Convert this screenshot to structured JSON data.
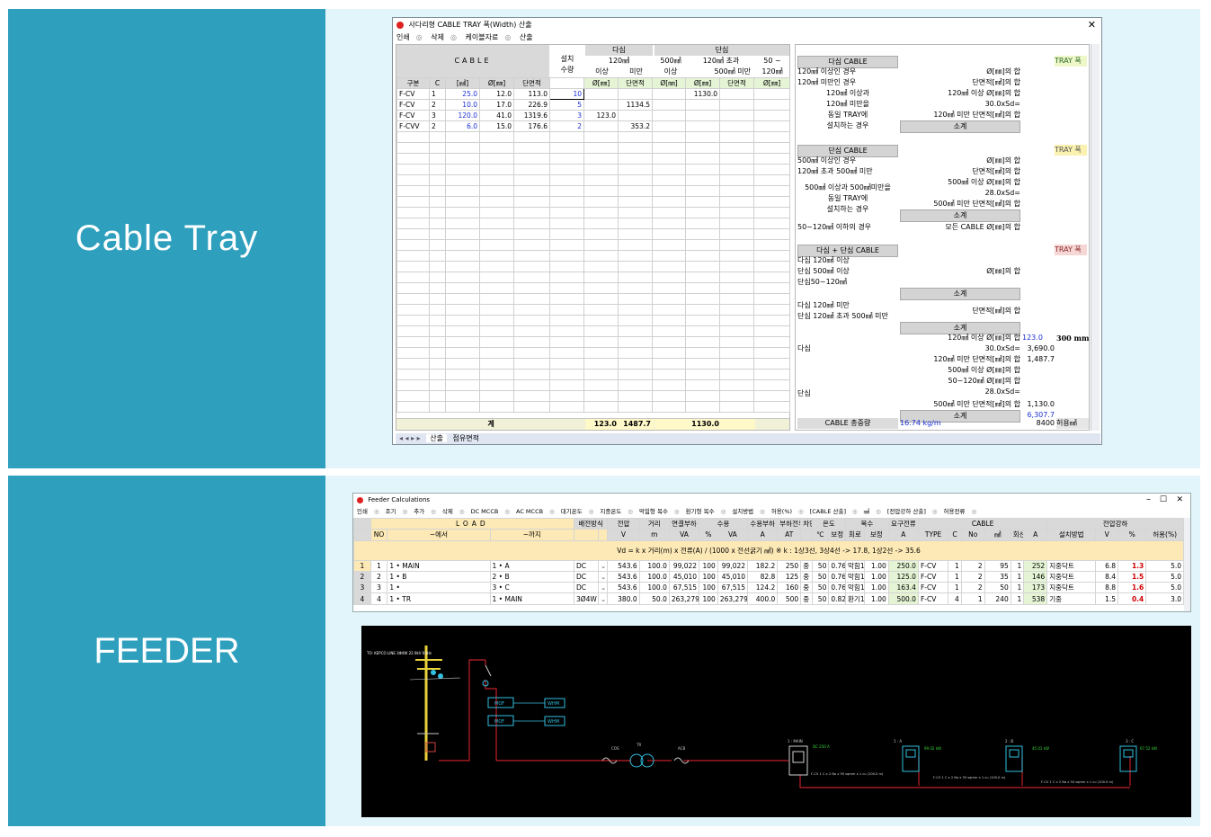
{
  "bands": {
    "top": "Cable Tray",
    "bottom": "FEEDER"
  },
  "tray": {
    "title": "사다리형 CABLE TRAY 폭(Width) 산출",
    "menu": [
      "인쇄",
      "삭제",
      "케이블자료",
      "산출"
    ],
    "head": {
      "cable": "CABLE",
      "install": "설치",
      "qty": "수량",
      "multi": "다심",
      "single": "단심",
      "m120": "120㎟",
      "above": "이상",
      "below": "미만",
      "s500": "500㎟",
      "s120over": "120㎟ 초과",
      "s500below": "500㎟ 미만",
      "s50": "50 ~",
      "s120": "120㎟",
      "phi": "Ø[㎜]",
      "area": "단면적",
      "gubun": "구분",
      "c": "C",
      "mm2": "[㎟]",
      "phimm": "Ø[㎜]",
      "areacol": "단면적"
    },
    "rows": [
      {
        "type": "F-CV",
        "c": "1",
        "sq": "25.0",
        "phi": "12.0",
        "area": "113.0",
        "qty": "10",
        "a": "",
        "b": "",
        "s1": "",
        "s2": "1130.0",
        "s3": ""
      },
      {
        "type": "F-CV",
        "c": "2",
        "sq": "10.0",
        "phi": "17.0",
        "area": "226.9",
        "qty": "5",
        "a": "",
        "b": "1134.5",
        "s1": "",
        "s2": "",
        "s3": ""
      },
      {
        "type": "F-CV",
        "c": "3",
        "sq": "120.0",
        "phi": "41.0",
        "area": "1319.6",
        "qty": "3",
        "a": "123.0",
        "b": "",
        "s1": "",
        "s2": "",
        "s3": ""
      },
      {
        "type": "F-CVV",
        "c": "2",
        "sq": "6.0",
        "phi": "15.0",
        "area": "176.6",
        "qty": "2",
        "a": "",
        "b": "353.2",
        "s1": "",
        "s2": "",
        "s3": ""
      }
    ],
    "total": {
      "label": "계",
      "a": "123.0",
      "b": "1487.7",
      "s": "1130.0"
    },
    "tabs": [
      "산출",
      "점유면적"
    ],
    "right": {
      "g1": "다심 CABLE",
      "tray": "TRAY 폭",
      "g1r": [
        "120㎟ 이상인 경우",
        "120㎟ 미만인 경우",
        "120㎟ 이상과",
        "120㎟ 미만을",
        "동일 TRAY에",
        "설치하는 경우"
      ],
      "g1v": [
        "Ø[㎜]의 합",
        "단면적[㎟]의 합",
        "120㎟ 이상 Ø[㎜]의 합",
        "30.0xSd=",
        "120㎟ 미만 단면적[㎟]의 합",
        "소계"
      ],
      "g2": "단심 CABLE",
      "g2r": [
        "500㎟ 이상인 경우",
        "120㎟ 초과 500㎟ 미만",
        "500㎟ 이상과 500㎟미만을",
        "동일 TRAY에",
        "설치하는 경우",
        "50~120㎟ 이하의 경우"
      ],
      "g2v": [
        "Ø[㎜]의 합",
        "단면적[㎟]의 합",
        "500㎟ 이상 Ø[㎜]의 합",
        "28.0xSd=",
        "500㎟ 미만 단면적[㎟]의 합",
        "소계",
        "모든 CABLE Ø[㎜]의 합"
      ],
      "g3": "다심 + 단심 CABLE",
      "g3r": [
        "다심 120㎟ 이상",
        "단심 500㎟ 이상",
        "단심50~120㎟",
        "다심 120㎟ 미만",
        "단심 120㎟ 초과 500㎟ 미만",
        "다심",
        "단심"
      ],
      "g3v": [
        "Ø[㎜]의 합",
        "소계",
        "단면적[㎟]의 합",
        "소계",
        "120㎟ 이상 Ø[㎜]의 합",
        "30.0xSd=",
        "120㎟ 미만 단면적[㎟]의 합",
        "500㎟ 이상 Ø[㎜]의 합",
        "50~120㎟  Ø[㎜]의 합",
        "28.0xSd=",
        "500㎟ 미만 단면적[㎟]의 합",
        "소계"
      ],
      "vals": {
        "v1": "123.0",
        "v2": "3,690.0",
        "v3": "1,487.7",
        "v4": "1,130.0",
        "v5": "6,307.7",
        "result": "300 mm"
      },
      "weight": "CABLE 총중량",
      "weightv": "16.74 kg/m",
      "allow": "8400",
      "allowl": "허용㎟"
    }
  },
  "feeder": {
    "title": "Feeder Calculations",
    "menu": [
      "인쇄",
      "조기",
      "추가",
      "삭제",
      "DC MCCB",
      "AC MCCB",
      "대기온도",
      "지중온도",
      "막힘형 복수",
      "환기형 복수",
      "설치방법",
      "허용(%)",
      "[CABLE 산출]",
      "㎟",
      "[전압강하 산출]",
      "허용전류"
    ],
    "head1": [
      "LOAD",
      "배전방식",
      "전압",
      "거리",
      "연결부하",
      "수용",
      "수용부하",
      "부하전류",
      "차단기",
      "온도",
      "복수",
      "요구전류",
      "CABLE",
      "전압강하"
    ],
    "head2": [
      "NO",
      "~에서",
      "~까지",
      "V",
      "m",
      "VA",
      "%",
      "VA",
      "A",
      "AT",
      "℃",
      "보정",
      "회로",
      "보정",
      "A",
      "TYPE",
      "C",
      "No",
      "㎟",
      "회선",
      "A",
      "설치방법",
      "V",
      "%",
      "허용(%)"
    ],
    "formula": "Vd = k x 거리(m) x 전류(A) / (1000 x 전선굵기 ㎟)          ※ k : 1상3선, 3상4선 -> 17.8,   1상2선 -> 35.6",
    "rows": [
      [
        "1",
        "1",
        "1 • MAIN",
        "1 • A",
        "DC",
        "543.6",
        "100.0",
        "99,022",
        "100",
        "99,022",
        "182.2",
        "250",
        "중",
        "50",
        "0.76",
        "막힘1",
        "1.00",
        "250.0",
        "F-CV",
        "1",
        "2",
        "95",
        "1",
        "252",
        "지중닥트",
        "6.8",
        "1.3",
        "5.0"
      ],
      [
        "2",
        "2",
        "1 • B",
        "2 • B",
        "DC",
        "543.6",
        "100.0",
        "45,010",
        "100",
        "45,010",
        "82.8",
        "125",
        "중",
        "50",
        "0.76",
        "막힘1",
        "1.00",
        "125.0",
        "F-CV",
        "1",
        "2",
        "35",
        "1",
        "146",
        "지중닥트",
        "8.4",
        "1.5",
        "5.0"
      ],
      [
        "3",
        "3",
        "1 •",
        "3 • C",
        "DC",
        "543.6",
        "100.0",
        "67,515",
        "100",
        "67,515",
        "124.2",
        "160",
        "중",
        "50",
        "0.76",
        "막힘1",
        "1.00",
        "163.4",
        "F-CV",
        "1",
        "2",
        "50",
        "1",
        "173",
        "지중닥트",
        "8.8",
        "1.6",
        "5.0"
      ],
      [
        "4",
        "4",
        "1 • TR",
        "1 • MAIN",
        "3Ø4W",
        "380.0",
        "50.0",
        "263,279",
        "100",
        "263,279",
        "400.0",
        "500",
        "중",
        "50",
        "0.82",
        "환기1",
        "1.00",
        "500.0",
        "F-CV",
        "4",
        "1",
        "240",
        "1",
        "538",
        "기중",
        "1.5",
        "0.4",
        "3.0"
      ]
    ],
    "diagram": {
      "kepco": "TO: KEPCO LINE 3Φ4W 22.9kV 60Hz",
      "mof": "MOF",
      "whm": "WHM",
      "cos": "COS",
      "tr": "TR",
      "acb": "ACB",
      "main": "1 : MAIN",
      "a": "1 : A",
      "b": "2 : B",
      "c": "3 : C",
      "dc1": "DC 250 A",
      "kw1": "99.02 kW",
      "kw2": "45.01 kW",
      "kw3": "67.52 kW",
      "cab1": "F-CV 1 C x 2 No x 95 sqmm x 1 cu (100.0 m)",
      "cab2": "F-CV 1 C x 2 No x 35 sqmm x 1 cu (100.0 m)",
      "cab3": "F-CV 1 C x 2 No x 50 sqmm x 1 cu (100.0 m)"
    }
  }
}
